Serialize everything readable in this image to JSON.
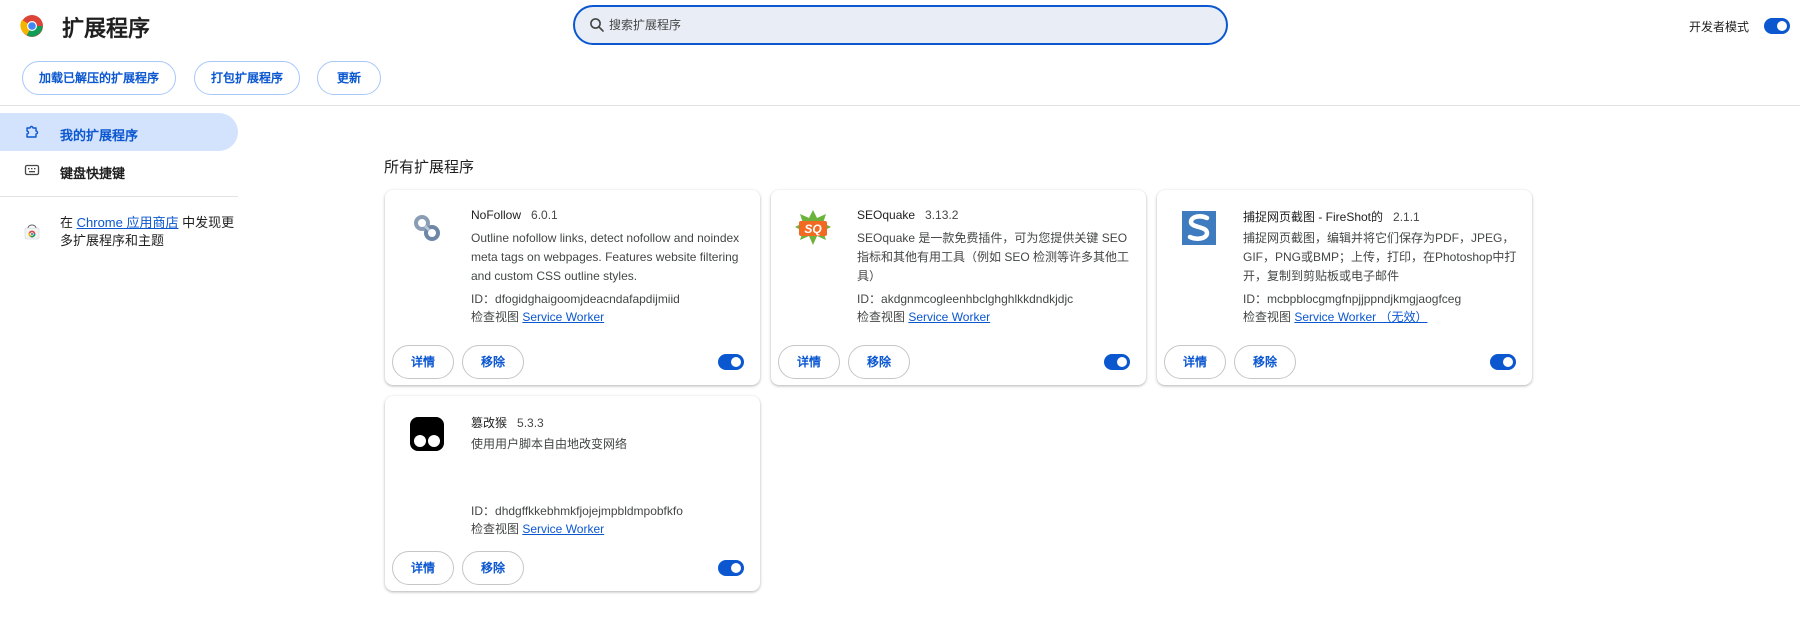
{
  "header": {
    "title": "扩展程序",
    "search_placeholder": "搜索扩展程序",
    "dev_mode_label": "开发者模式",
    "dev_mode_on": true,
    "accent_color": "#0b57d0"
  },
  "toolbar": {
    "load_unpacked_label": "加载已解压的扩展程序",
    "pack_label": "打包扩展程序",
    "update_label": "更新"
  },
  "sidebar": {
    "items": [
      {
        "label": "我的扩展程序",
        "icon": "puzzle-icon",
        "active": true
      },
      {
        "label": "键盘快捷键",
        "icon": "keyboard-icon",
        "active": false
      }
    ],
    "store_prefix": "在 ",
    "store_link": "Chrome 应用商店",
    "store_suffix": " 中发现更多扩展程序和主题"
  },
  "main": {
    "section_title": "所有扩展程序",
    "details_label": "详情",
    "remove_label": "移除",
    "id_prefix": "ID：",
    "inspect_prefix": "检查视图 ",
    "extensions": [
      {
        "name": "NoFollow",
        "version": "6.0.1",
        "description": "Outline nofollow links, detect nofollow and noindex meta tags on webpages. Features website filtering and custom CSS outline styles.",
        "id": "dfogidghaigoomjdeacndafapdijmiid",
        "inspect_link": "Service Worker",
        "enabled": true,
        "icon": "nofollow-icon"
      },
      {
        "name": "SEOquake",
        "version": "3.13.2",
        "description": "SEOquake 是一款免费插件，可为您提供关键 SEO 指标和其他有用工具（例如 SEO 检测等许多其他工具）",
        "id": "akdgnmcogleenhbclghghlkkdndkjdjc",
        "inspect_link": "Service Worker",
        "enabled": true,
        "icon": "seoquake-icon"
      },
      {
        "name": "捕捉网页截图 - FireShot的",
        "version": "2.1.1",
        "description": "捕捉网页截图，编辑并将它们保存为PDF，JPEG，GIF，PNG或BMP；上传，打印，在Photoshop中打开，复制到剪贴板或电子邮件",
        "id": "mcbpblocgmgfnpjjppndjkmgjaogfceg",
        "inspect_link": "Service Worker （无效）",
        "enabled": true,
        "icon": "fireshot-icon"
      },
      {
        "name": "篡改猴",
        "version": "5.3.3",
        "description": "使用用户脚本自由地改变网络",
        "id": "dhdgffkkebhmkfjojejmpbldmpobfkfo",
        "inspect_link": "Service Worker",
        "enabled": true,
        "icon": "tampermonkey-icon"
      }
    ]
  }
}
